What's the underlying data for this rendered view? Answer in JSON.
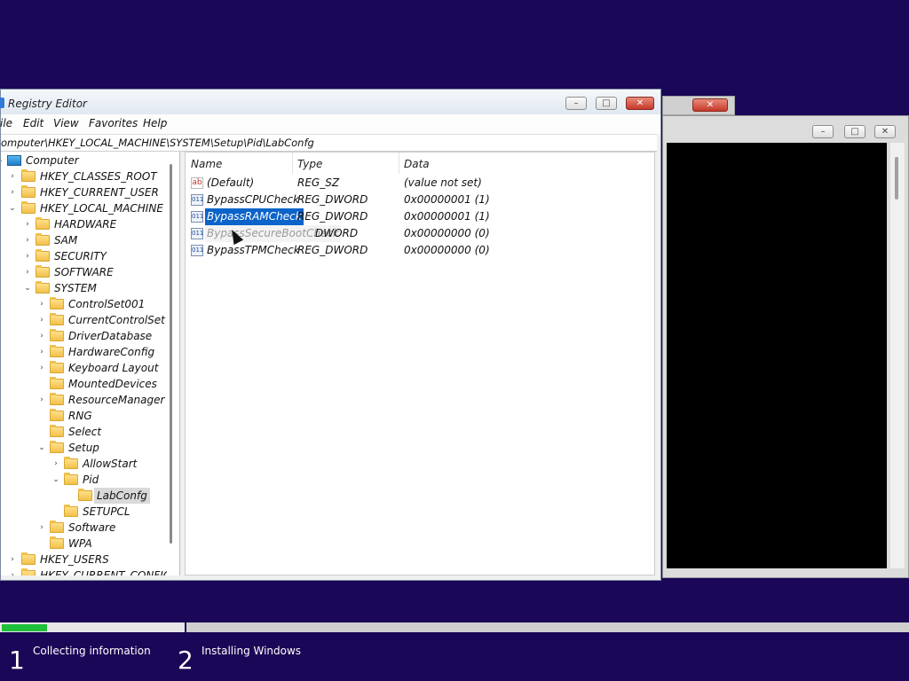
{
  "colors": {
    "desktop": "#1b0757",
    "selection": "#0c63c9",
    "progress_fill": "#1fbf3b"
  },
  "regedit": {
    "title": "Registry Editor",
    "menu": [
      "ile",
      "Edit",
      "View",
      "Favorites",
      "Help"
    ],
    "address": "omputer\\HKEY_LOCAL_MACHINE\\SYSTEM\\Setup\\Pid\\LabConfg",
    "tree": {
      "computer": "Computer",
      "hkcr": "HKEY_CLASSES_ROOT",
      "hkcu": "HKEY_CURRENT_USER",
      "hklm": "HKEY_LOCAL_MACHINE",
      "hardware": "HARDWARE",
      "sam": "SAM",
      "security": "SECURITY",
      "software": "SOFTWARE",
      "system": "SYSTEM",
      "controlset001": "ControlSet001",
      "currentcontrolset": "CurrentControlSet",
      "driverdatabase": "DriverDatabase",
      "hardwareconfig": "HardwareConfig",
      "keyboardlayout": "Keyboard Layout",
      "mounteddevices": "MountedDevices",
      "resourcemanager": "ResourceManager",
      "rng": "RNG",
      "select": "Select",
      "setup": "Setup",
      "allowstart": "AllowStart",
      "pid": "Pid",
      "labconfg": "LabConfg",
      "setupcl": "SETUPCL",
      "software2": "Software",
      "wpa": "WPA",
      "hku": "HKEY_USERS",
      "hkcc": "HKEY_CURRENT_CONFIG"
    },
    "columns": {
      "name": "Name",
      "type": "Type",
      "data": "Data"
    },
    "values": [
      {
        "name": "(Default)",
        "type": "REG_SZ",
        "data": "(value not set)",
        "icon": "ab-string-icon"
      },
      {
        "name": "BypassCPUCheck",
        "type": "REG_DWORD",
        "data": "0x00000001 (1)",
        "icon": "dword-icon"
      },
      {
        "name": "BypassRAMCheck",
        "type": "REG_DWORD",
        "data": "0x00000001 (1)",
        "icon": "dword-icon"
      },
      {
        "name": "BypassSecureBootCheck",
        "type": "DWORD",
        "data": "0x00000000 (0)",
        "icon": "dword-icon"
      },
      {
        "name": "BypassTPMCheck",
        "type": "REG_DWORD",
        "data": "0x00000000 (0)",
        "icon": "dword-icon"
      }
    ]
  },
  "setup_progress": {
    "progress_percent": 25,
    "steps": [
      {
        "number": "1",
        "label": "Collecting information"
      },
      {
        "number": "2",
        "label": "Installing Windows"
      }
    ]
  }
}
